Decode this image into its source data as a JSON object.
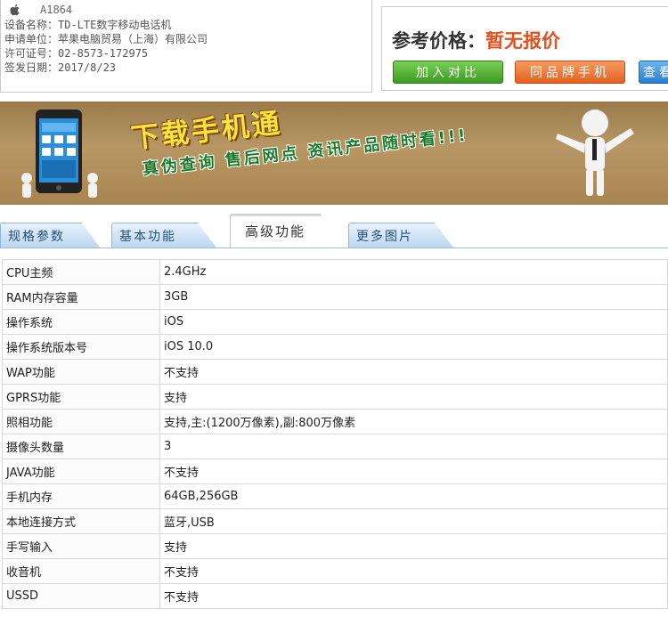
{
  "device": {
    "model": "A1864",
    "lines": [
      "设备名称：TD-LTE数字移动电话机",
      "申请单位：苹果电脑贸易（上海）有限公司",
      "许可证号：02-8573-172975",
      "签发日期：2017/8/23"
    ]
  },
  "price": {
    "label": "参考价格：",
    "value": "暂无报价"
  },
  "buttons": {
    "compare": "加入对比",
    "same_brand": "同品牌手机",
    "view": "查看"
  },
  "banner": {
    "title": "下载手机通",
    "slogan": "真伪查询 售后网点 资讯产品随时看!!!"
  },
  "tabs": [
    {
      "label": "规格参数"
    },
    {
      "label": "基本功能"
    },
    {
      "label": "高级功能"
    },
    {
      "label": "更多图片"
    }
  ],
  "specs": [
    {
      "key": "CPU主频",
      "value": "2.4GHz"
    },
    {
      "key": "RAM内存容量",
      "value": "3GB"
    },
    {
      "key": "操作系统",
      "value": "iOS"
    },
    {
      "key": "操作系统版本号",
      "value": "iOS 10.0"
    },
    {
      "key": "WAP功能",
      "value": "不支持"
    },
    {
      "key": "GPRS功能",
      "value": "支持"
    },
    {
      "key": "照相功能",
      "value": "支持,主:(1200万像素),副:800万像素"
    },
    {
      "key": "摄像头数量",
      "value": "3"
    },
    {
      "key": "JAVA功能",
      "value": "不支持"
    },
    {
      "key": "手机内存",
      "value": "64GB,256GB"
    },
    {
      "key": "本地连接方式",
      "value": "蓝牙,USB"
    },
    {
      "key": "手写输入",
      "value": "支持"
    },
    {
      "key": "收音机",
      "value": "不支持"
    },
    {
      "key": "USSD",
      "value": "不支持"
    }
  ],
  "colors": {
    "price_accent": "#e3501e",
    "compare_button": "#3d9a23",
    "brand_button": "#e3611f",
    "view_button": "#2a7dd0",
    "tab_blue": "#bcd8f0"
  }
}
